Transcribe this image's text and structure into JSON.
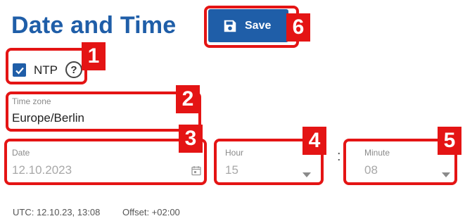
{
  "page": {
    "title": "Date and Time"
  },
  "toolbar": {
    "save_label": "Save",
    "save_icon": "floppy-disk-icon"
  },
  "ntp": {
    "label": "NTP",
    "checked": true,
    "help_icon": "question-circle-icon"
  },
  "timezone": {
    "label": "Time zone",
    "value": "Europe/Berlin"
  },
  "date": {
    "label": "Date",
    "value": "12.10.2023",
    "icon": "calendar-icon"
  },
  "hour": {
    "label": "Hour",
    "value": "15"
  },
  "separator": ":",
  "minute": {
    "label": "Minute",
    "value": "08"
  },
  "footer": {
    "utc": "UTC: 12.10.23, 13:08",
    "offset": "Offset: +02:00"
  },
  "callouts": [
    "1",
    "2",
    "3",
    "4",
    "5",
    "6"
  ],
  "colors": {
    "accent": "#1f5ea8",
    "callout": "#e41414"
  }
}
